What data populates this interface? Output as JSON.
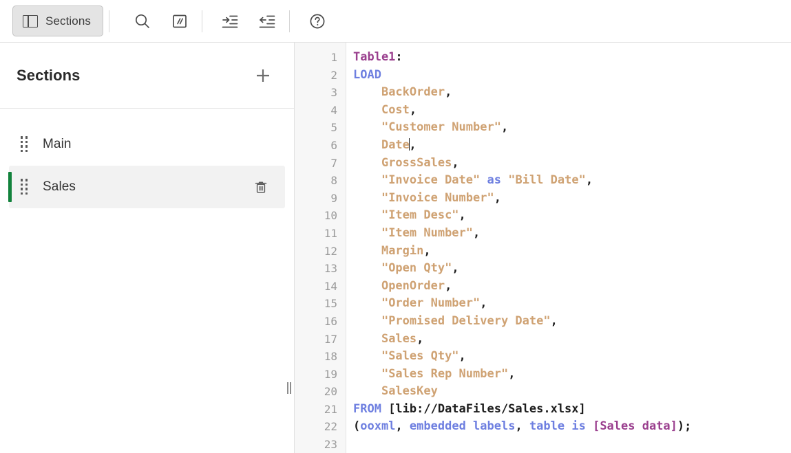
{
  "toolbar": {
    "sections_button": {
      "label": "Sections",
      "icon": "panel-left-icon",
      "active": true
    },
    "buttons": [
      {
        "name": "search-button",
        "icon": "search-icon",
        "title": "Search"
      },
      {
        "name": "comment-button",
        "icon": "comment-slashes-icon",
        "title": "Comment"
      },
      {
        "name": "indent-right-button",
        "icon": "indent-right-icon",
        "title": "Indent"
      },
      {
        "name": "indent-left-button",
        "icon": "indent-left-icon",
        "title": "Outdent"
      },
      {
        "name": "help-button",
        "icon": "help-circle-icon",
        "title": "Help"
      }
    ]
  },
  "sidebar": {
    "title": "Sections",
    "add_label": "+",
    "add_icon": "plus-icon",
    "items": [
      {
        "label": "Main",
        "selected": false,
        "deletable": false,
        "accent": ""
      },
      {
        "label": "Sales",
        "selected": true,
        "deletable": true,
        "accent": "#12823c",
        "delete_icon": "trash-icon"
      }
    ]
  },
  "editor": {
    "line_numbers": [
      "1",
      "2",
      "3",
      "4",
      "5",
      "6",
      "7",
      "8",
      "9",
      "10",
      "11",
      "12",
      "13",
      "14",
      "15",
      "16",
      "17",
      "18",
      "19",
      "20",
      "21",
      "22",
      "23"
    ],
    "cursor": {
      "line": 6,
      "column": 9
    },
    "colors": {
      "table_label": "#9a3f8e",
      "keyword": "#6e7fe0",
      "field": "#cfa273",
      "plain": "#1d1d1d",
      "gutter_text": "#9a9a9a",
      "gutter_bg": "#f7f7f7"
    },
    "lines": [
      {
        "n": 1,
        "text": "Table1:"
      },
      {
        "n": 2,
        "text": "LOAD"
      },
      {
        "n": 3,
        "text": "    BackOrder,"
      },
      {
        "n": 4,
        "text": "    Cost,"
      },
      {
        "n": 5,
        "text": "    \"Customer Number\","
      },
      {
        "n": 6,
        "text": "    Date,"
      },
      {
        "n": 7,
        "text": "    GrossSales,"
      },
      {
        "n": 8,
        "text": "    \"Invoice Date\" as \"Bill Date\","
      },
      {
        "n": 9,
        "text": "    \"Invoice Number\","
      },
      {
        "n": 10,
        "text": "    \"Item Desc\","
      },
      {
        "n": 11,
        "text": "    \"Item Number\","
      },
      {
        "n": 12,
        "text": "    Margin,"
      },
      {
        "n": 13,
        "text": "    \"Open Qty\","
      },
      {
        "n": 14,
        "text": "    OpenOrder,"
      },
      {
        "n": 15,
        "text": "    \"Order Number\","
      },
      {
        "n": 16,
        "text": "    \"Promised Delivery Date\","
      },
      {
        "n": 17,
        "text": "    Sales,"
      },
      {
        "n": 18,
        "text": "    \"Sales Qty\","
      },
      {
        "n": 19,
        "text": "    \"Sales Rep Number\","
      },
      {
        "n": 20,
        "text": "    SalesKey"
      },
      {
        "n": 21,
        "text": "FROM [lib://DataFiles/Sales.xlsx]"
      },
      {
        "n": 22,
        "text": "(ooxml, embedded labels, table is [Sales data]);"
      },
      {
        "n": 23,
        "text": ""
      }
    ],
    "tokens": [
      [
        {
          "t": "Table1",
          "c": "tok-table"
        },
        {
          "t": ":",
          "c": "tok-plain"
        }
      ],
      [
        {
          "t": "LOAD",
          "c": "tok-kw"
        }
      ],
      [
        {
          "t": "    ",
          "c": "tok-plain"
        },
        {
          "t": "BackOrder",
          "c": "tok-field"
        },
        {
          "t": ",",
          "c": "tok-plain"
        }
      ],
      [
        {
          "t": "    ",
          "c": "tok-plain"
        },
        {
          "t": "Cost",
          "c": "tok-field"
        },
        {
          "t": ",",
          "c": "tok-plain"
        }
      ],
      [
        {
          "t": "    ",
          "c": "tok-plain"
        },
        {
          "t": "\"Customer Number\"",
          "c": "tok-field"
        },
        {
          "t": ",",
          "c": "tok-plain"
        }
      ],
      [
        {
          "t": "    ",
          "c": "tok-plain"
        },
        {
          "t": "Date",
          "c": "tok-field"
        },
        {
          "t": "__CARET__",
          "c": "caret-marker"
        },
        {
          "t": ",",
          "c": "tok-plain"
        }
      ],
      [
        {
          "t": "    ",
          "c": "tok-plain"
        },
        {
          "t": "GrossSales",
          "c": "tok-field"
        },
        {
          "t": ",",
          "c": "tok-plain"
        }
      ],
      [
        {
          "t": "    ",
          "c": "tok-plain"
        },
        {
          "t": "\"Invoice Date\"",
          "c": "tok-field"
        },
        {
          "t": " ",
          "c": "tok-plain"
        },
        {
          "t": "as",
          "c": "tok-kw"
        },
        {
          "t": " ",
          "c": "tok-plain"
        },
        {
          "t": "\"Bill Date\"",
          "c": "tok-field"
        },
        {
          "t": ",",
          "c": "tok-plain"
        }
      ],
      [
        {
          "t": "    ",
          "c": "tok-plain"
        },
        {
          "t": "\"Invoice Number\"",
          "c": "tok-field"
        },
        {
          "t": ",",
          "c": "tok-plain"
        }
      ],
      [
        {
          "t": "    ",
          "c": "tok-plain"
        },
        {
          "t": "\"Item Desc\"",
          "c": "tok-field"
        },
        {
          "t": ",",
          "c": "tok-plain"
        }
      ],
      [
        {
          "t": "    ",
          "c": "tok-plain"
        },
        {
          "t": "\"Item Number\"",
          "c": "tok-field"
        },
        {
          "t": ",",
          "c": "tok-plain"
        }
      ],
      [
        {
          "t": "    ",
          "c": "tok-plain"
        },
        {
          "t": "Margin",
          "c": "tok-field"
        },
        {
          "t": ",",
          "c": "tok-plain"
        }
      ],
      [
        {
          "t": "    ",
          "c": "tok-plain"
        },
        {
          "t": "\"Open Qty\"",
          "c": "tok-field"
        },
        {
          "t": ",",
          "c": "tok-plain"
        }
      ],
      [
        {
          "t": "    ",
          "c": "tok-plain"
        },
        {
          "t": "OpenOrder",
          "c": "tok-field"
        },
        {
          "t": ",",
          "c": "tok-plain"
        }
      ],
      [
        {
          "t": "    ",
          "c": "tok-plain"
        },
        {
          "t": "\"Order Number\"",
          "c": "tok-field"
        },
        {
          "t": ",",
          "c": "tok-plain"
        }
      ],
      [
        {
          "t": "    ",
          "c": "tok-plain"
        },
        {
          "t": "\"Promised Delivery Date\"",
          "c": "tok-field"
        },
        {
          "t": ",",
          "c": "tok-plain"
        }
      ],
      [
        {
          "t": "    ",
          "c": "tok-plain"
        },
        {
          "t": "Sales",
          "c": "tok-field"
        },
        {
          "t": ",",
          "c": "tok-plain"
        }
      ],
      [
        {
          "t": "    ",
          "c": "tok-plain"
        },
        {
          "t": "\"Sales Qty\"",
          "c": "tok-field"
        },
        {
          "t": ",",
          "c": "tok-plain"
        }
      ],
      [
        {
          "t": "    ",
          "c": "tok-plain"
        },
        {
          "t": "\"Sales Rep Number\"",
          "c": "tok-field"
        },
        {
          "t": ",",
          "c": "tok-plain"
        }
      ],
      [
        {
          "t": "    ",
          "c": "tok-plain"
        },
        {
          "t": "SalesKey",
          "c": "tok-field"
        }
      ],
      [
        {
          "t": "FROM",
          "c": "tok-kw"
        },
        {
          "t": " [lib://DataFiles/Sales.xlsx]",
          "c": "tok-path"
        }
      ],
      [
        {
          "t": "(",
          "c": "tok-plain"
        },
        {
          "t": "ooxml",
          "c": "tok-kw"
        },
        {
          "t": ", ",
          "c": "tok-plain"
        },
        {
          "t": "embedded labels",
          "c": "tok-kw"
        },
        {
          "t": ", ",
          "c": "tok-plain"
        },
        {
          "t": "table is",
          "c": "tok-kw"
        },
        {
          "t": " ",
          "c": "tok-plain"
        },
        {
          "t": "[Sales data]",
          "c": "tok-bracket"
        },
        {
          "t": ");",
          "c": "tok-plain"
        }
      ],
      []
    ]
  }
}
